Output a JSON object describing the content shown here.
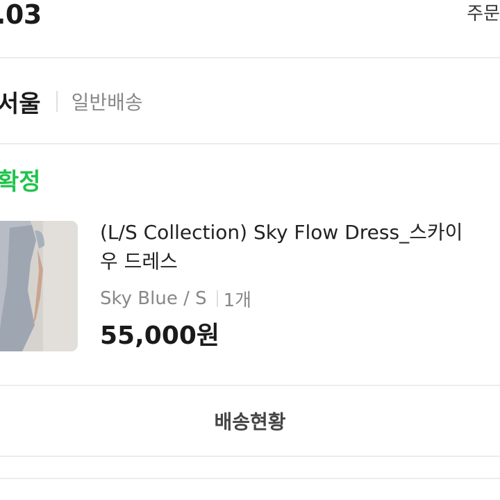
{
  "header": {
    "date": ".03",
    "order_link": "주문"
  },
  "shipping": {
    "location": "서울",
    "type": "일반배송"
  },
  "order": {
    "status": "확정",
    "status_color": "#1fc44c"
  },
  "product": {
    "name_line1": "(L/S Collection) Sky Flow Dress_스카이",
    "name_line2": "우 드레스",
    "option": "Sky Blue / S",
    "quantity": "1개",
    "price": "55,000원"
  },
  "actions": {
    "track_label": "배송현황"
  }
}
